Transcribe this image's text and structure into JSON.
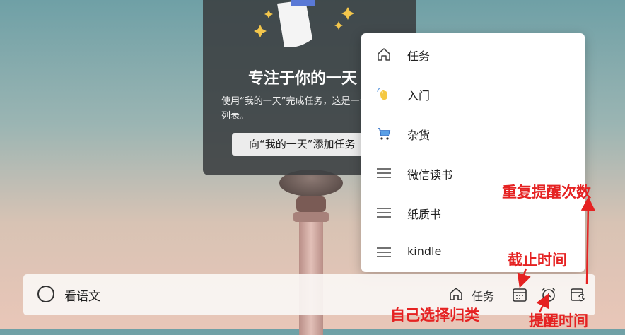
{
  "focus_card": {
    "title": "专注于你的一天",
    "description": "使用“我的一天”完成任务，这是一个每天都会刷新的列表。",
    "add_button": "向“我的一天”添加任务"
  },
  "dropdown": {
    "items": [
      {
        "label": "任务",
        "icon": "home-icon"
      },
      {
        "label": "入门",
        "icon": "waving-hand-icon"
      },
      {
        "label": "杂货",
        "icon": "shopping-cart-icon"
      },
      {
        "label": "微信读书",
        "icon": "list-icon"
      },
      {
        "label": "纸质书",
        "icon": "list-icon"
      },
      {
        "label": "kindle",
        "icon": "list-icon"
      }
    ]
  },
  "task_bar": {
    "input_value": "看语文",
    "list_chip_label": "任务"
  },
  "annotations": {
    "repeat": "重复提醒次数",
    "due": "截止时间",
    "category": "自己选择归类",
    "reminder": "提醒时间",
    "color": "#e52222"
  }
}
